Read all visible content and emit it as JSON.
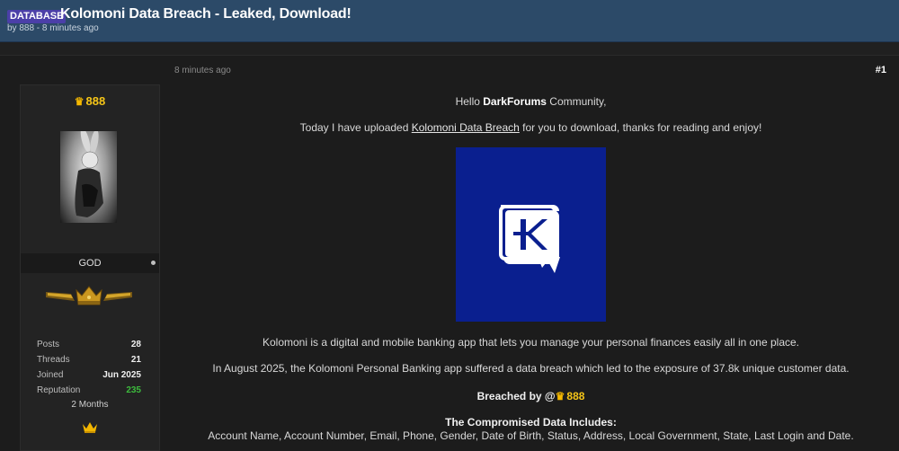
{
  "header": {
    "prefix": "DATABASE",
    "title": "Kolomoni Data Breach - Leaked, Download!",
    "meta": "by 888 - 8 minutes ago"
  },
  "post": {
    "time": "8 minutes ago",
    "number": "#1"
  },
  "user": {
    "name": "888",
    "title": "GOD",
    "stats": [
      {
        "label": "Posts",
        "value": "28"
      },
      {
        "label": "Threads",
        "value": "21"
      },
      {
        "label": "Joined",
        "value": "Jun 2025"
      },
      {
        "label": "Reputation",
        "value": "235"
      }
    ],
    "member_duration": "2 Months"
  },
  "body": {
    "greeting_pre": "Hello ",
    "greeting_bold": "DarkForums",
    "greeting_post": " Community,",
    "intro_pre": "Today I have uploaded ",
    "intro_link": "Kolomoni Data Breach",
    "intro_post": " for you to download, thanks for reading and enjoy!",
    "description": "Kolomoni is a digital and mobile banking app that lets you manage your personal finances easily all in one place.",
    "breach_info": "In August 2025, the Kolomoni Personal Banking app suffered a data breach which led to the exposure of 37.8k unique customer data.",
    "breached_by_label": "Breached by @",
    "breached_by_user": "888",
    "data_heading": "The Compromised Data Includes:",
    "data_fields": "Account Name, Account Number, Email, Phone, Gender, Date of Birth, Status, Address, Local Government, State, Last Login and Date."
  },
  "colors": {
    "header_bg": "#2c4a68",
    "badge_bg": "#4b3fa8",
    "username": "#f5c518",
    "reputation": "#3dbb3d",
    "logo_bg": "#0a1f8f"
  }
}
